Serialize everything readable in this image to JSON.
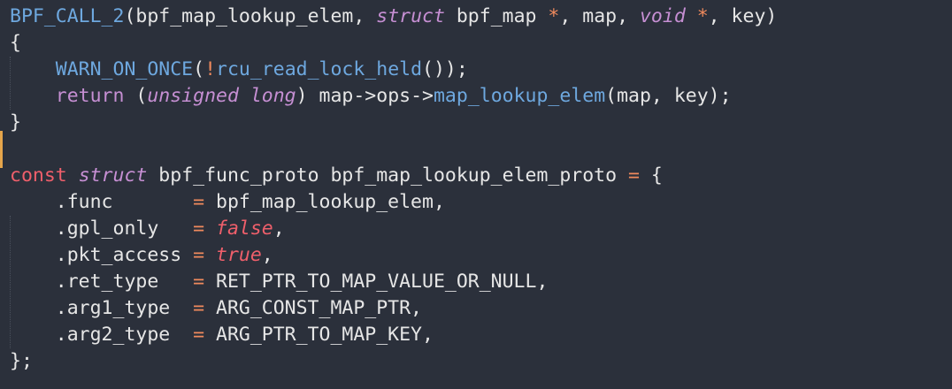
{
  "editor": {
    "lines": [
      [
        {
          "t": "BPF_CALL_2",
          "c": "c-macro"
        },
        {
          "t": "(",
          "c": "c-punct"
        },
        {
          "t": "bpf_map_lookup_elem",
          "c": "c-ident"
        },
        {
          "t": ", ",
          "c": "c-punct"
        },
        {
          "t": "struct",
          "c": "c-kw-italic"
        },
        {
          "t": " bpf_map ",
          "c": "c-ident"
        },
        {
          "t": "*",
          "c": "c-op"
        },
        {
          "t": ", map, ",
          "c": "c-ident"
        },
        {
          "t": "void",
          "c": "c-kw-italic"
        },
        {
          "t": " ",
          "c": "c-ident"
        },
        {
          "t": "*",
          "c": "c-op"
        },
        {
          "t": ", key)",
          "c": "c-ident"
        }
      ],
      [
        {
          "t": "{",
          "c": "c-punct"
        }
      ],
      [
        {
          "t": "    ",
          "c": "c-punct"
        },
        {
          "t": "WARN_ON_ONCE",
          "c": "c-macro"
        },
        {
          "t": "(",
          "c": "c-punct"
        },
        {
          "t": "!",
          "c": "c-op"
        },
        {
          "t": "rcu_read_lock_held",
          "c": "c-macro"
        },
        {
          "t": "());",
          "c": "c-punct"
        }
      ],
      [
        {
          "t": "    ",
          "c": "c-punct"
        },
        {
          "t": "return",
          "c": "c-kw"
        },
        {
          "t": " (",
          "c": "c-punct"
        },
        {
          "t": "unsigned long",
          "c": "c-kw-italic"
        },
        {
          "t": ") map",
          "c": "c-ident"
        },
        {
          "t": "->",
          "c": "c-arrow"
        },
        {
          "t": "ops",
          "c": "c-ident"
        },
        {
          "t": "->",
          "c": "c-arrow"
        },
        {
          "t": "map_lookup_elem",
          "c": "c-macro"
        },
        {
          "t": "(map, key);",
          "c": "c-ident"
        }
      ],
      [
        {
          "t": "}",
          "c": "c-punct"
        }
      ],
      [],
      [
        {
          "t": "const",
          "c": "c-const"
        },
        {
          "t": " ",
          "c": "c-ident"
        },
        {
          "t": "struct",
          "c": "c-kw-italic"
        },
        {
          "t": " bpf_func_proto bpf_map_lookup_elem_proto ",
          "c": "c-ident"
        },
        {
          "t": "=",
          "c": "c-op"
        },
        {
          "t": " {",
          "c": "c-punct"
        }
      ],
      [
        {
          "t": "    .func       ",
          "c": "c-member"
        },
        {
          "t": "=",
          "c": "c-op"
        },
        {
          "t": " bpf_map_lookup_elem,",
          "c": "c-ident"
        }
      ],
      [
        {
          "t": "    .gpl_only   ",
          "c": "c-member"
        },
        {
          "t": "=",
          "c": "c-op"
        },
        {
          "t": " ",
          "c": "c-ident"
        },
        {
          "t": "false",
          "c": "c-bool"
        },
        {
          "t": ",",
          "c": "c-punct"
        }
      ],
      [
        {
          "t": "    .pkt_access ",
          "c": "c-member"
        },
        {
          "t": "=",
          "c": "c-op"
        },
        {
          "t": " ",
          "c": "c-ident"
        },
        {
          "t": "true",
          "c": "c-bool"
        },
        {
          "t": ",",
          "c": "c-punct"
        }
      ],
      [
        {
          "t": "    .ret_type   ",
          "c": "c-member"
        },
        {
          "t": "=",
          "c": "c-op"
        },
        {
          "t": " RET_PTR_TO_MAP_VALUE_OR_NULL,",
          "c": "c-ident"
        }
      ],
      [
        {
          "t": "    .arg1_type  ",
          "c": "c-member"
        },
        {
          "t": "=",
          "c": "c-op"
        },
        {
          "t": " ARG_CONST_MAP_PTR,",
          "c": "c-ident"
        }
      ],
      [
        {
          "t": "    .arg2_type  ",
          "c": "c-member"
        },
        {
          "t": "=",
          "c": "c-op"
        },
        {
          "t": " ARG_PTR_TO_MAP_KEY,",
          "c": "c-ident"
        }
      ],
      [
        {
          "t": "};",
          "c": "c-punct"
        }
      ]
    ]
  },
  "colors": {
    "background": "#2b303b",
    "text": "#e6e6e6",
    "macro": "#6ea8df",
    "keyword": "#c68fd3",
    "operator": "#f08a5d",
    "constant": "#ef5f6b",
    "gutter_marker": "#e5a54b"
  }
}
